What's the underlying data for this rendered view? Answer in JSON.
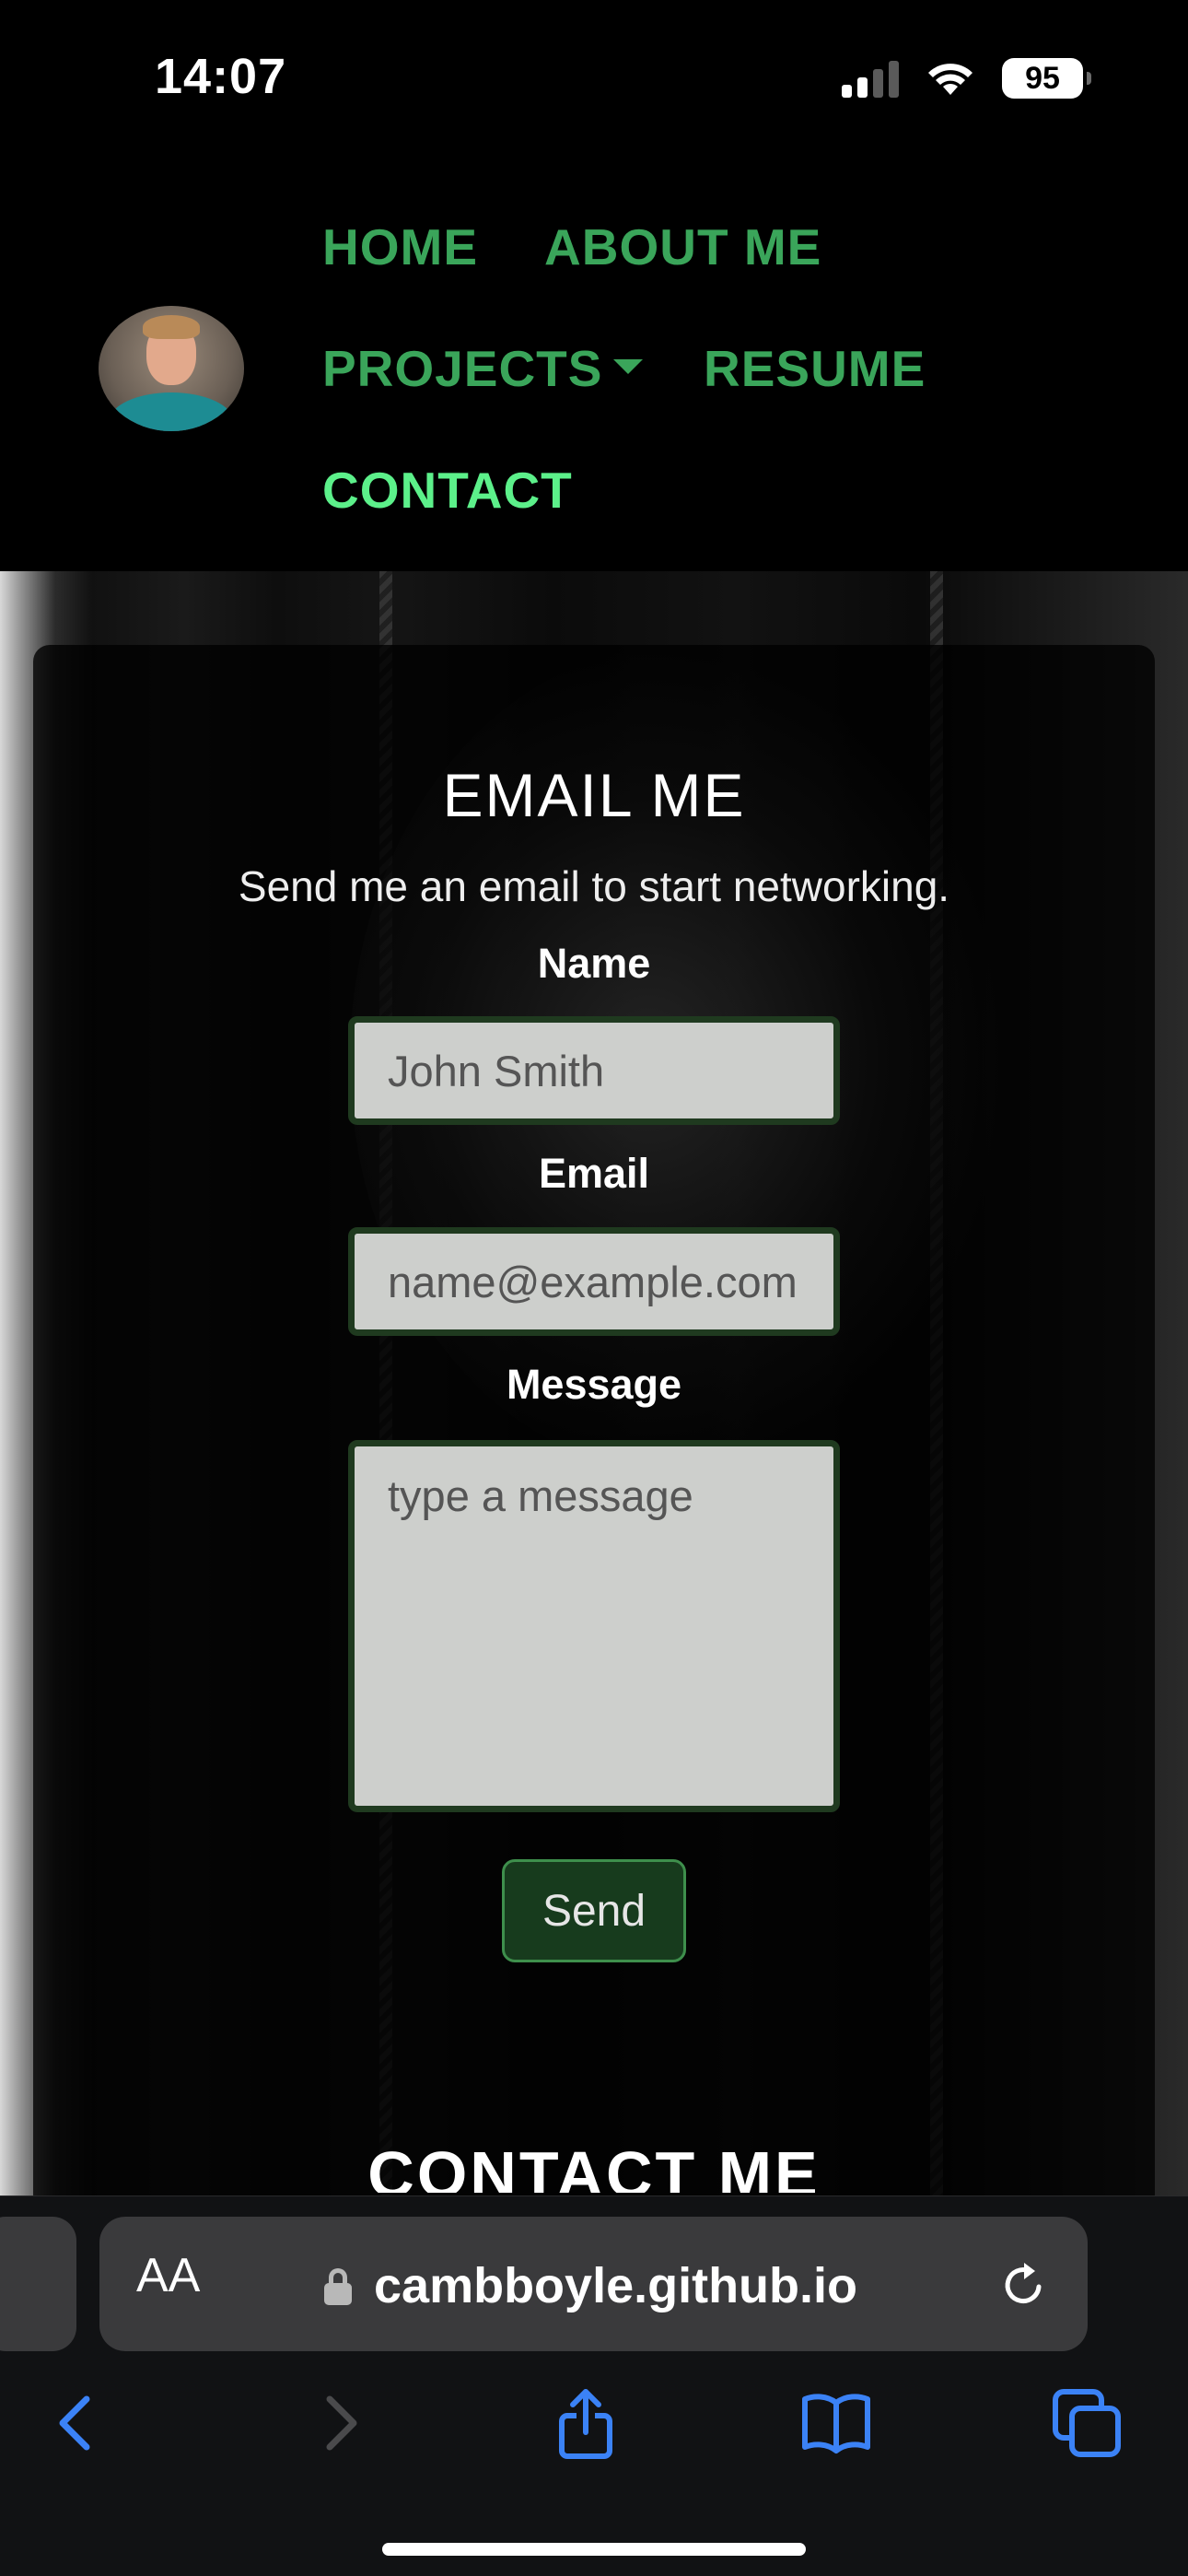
{
  "status_bar": {
    "time": "14:07",
    "battery": "95",
    "icons": [
      "signal-icon",
      "wifi-icon",
      "battery-icon"
    ]
  },
  "navbar": {
    "avatar": "profile-photo",
    "links": {
      "home": "HOME",
      "about": "ABOUT ME",
      "projects": "PROJECTS",
      "resume": "RESUME",
      "contact": "CONTACT"
    },
    "active_link": "CONTACT",
    "colors": {
      "link": "#3aa55a",
      "active": "#5cf08a"
    }
  },
  "email_form": {
    "title": "EMAIL ME",
    "subtitle": "Send me an email to start networking.",
    "name_label": "Name",
    "name_placeholder": "John Smith",
    "email_label": "Email",
    "email_placeholder": "name@example.com",
    "message_label": "Message",
    "message_placeholder": "type a message",
    "send_label": "Send"
  },
  "contact_section": {
    "title": "CONTACT ME"
  },
  "browser": {
    "text_size_label": "AA",
    "url": "cambboyle.github.io",
    "toolbar_icons": [
      "back-icon",
      "forward-icon",
      "share-icon",
      "bookmarks-icon",
      "tabs-icon"
    ],
    "accent": "#3b82f6"
  }
}
